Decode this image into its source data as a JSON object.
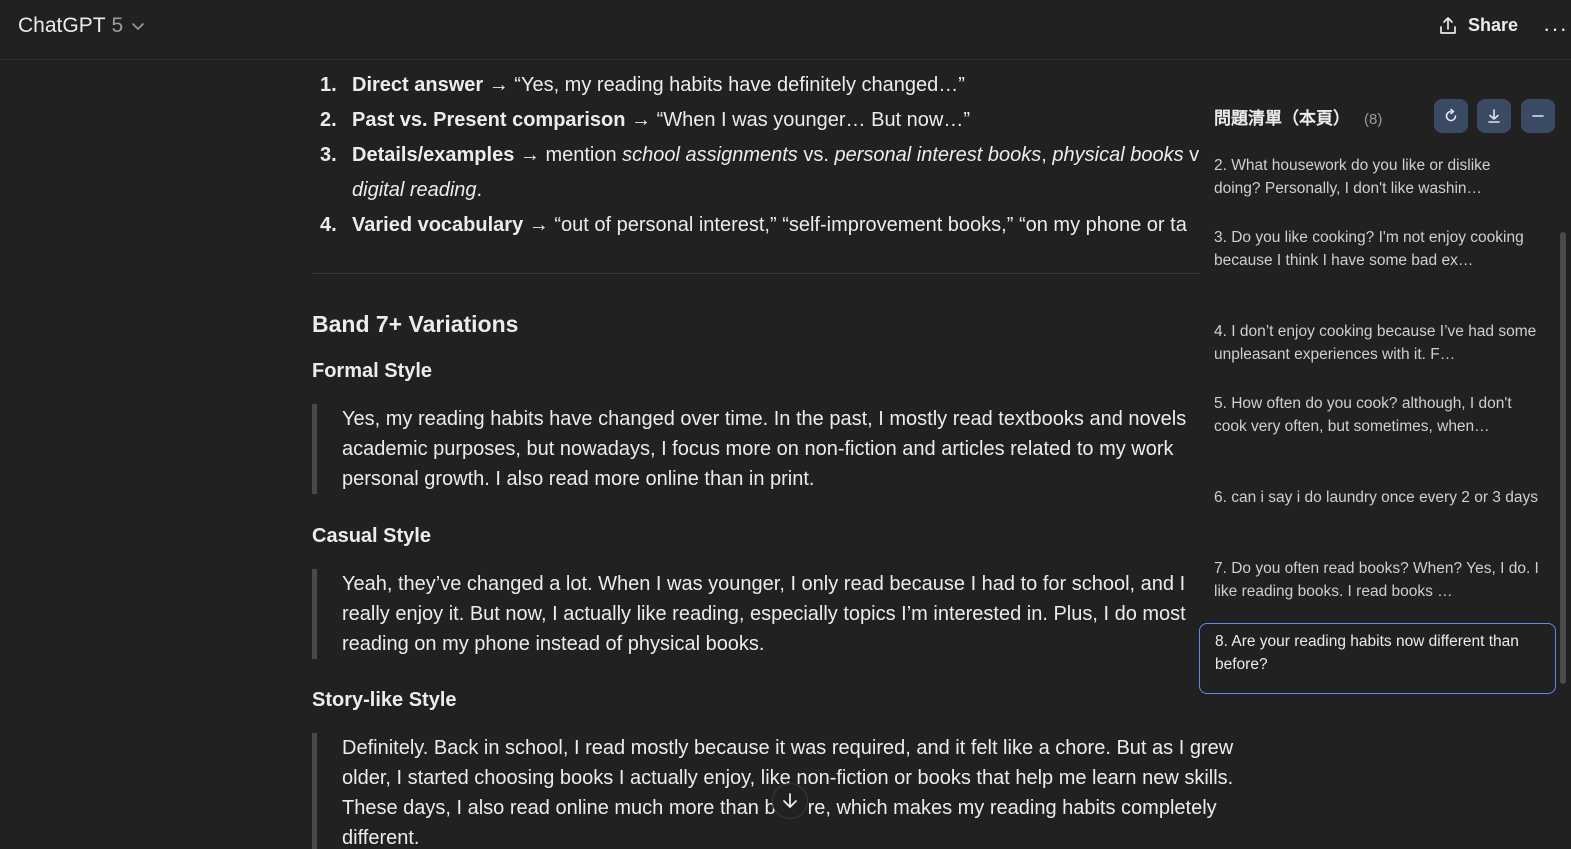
{
  "header": {
    "model_name": "ChatGPT",
    "model_version": "5",
    "share_label": "Share",
    "more_label": "···"
  },
  "answer": {
    "list": [
      {
        "num": "1.",
        "bold": "Direct answer",
        "rest": " → “Yes, my reading habits have definitely changed…”"
      },
      {
        "num": "2.",
        "bold": "Past vs. Present comparison",
        "rest": " → “When I was younger… But now…”"
      },
      {
        "num": "4.",
        "bold": "Varied vocabulary",
        "rest": " → “out of personal interest,” “self-improvement books,” “on my phone or ta"
      }
    ],
    "item3": {
      "num": "3.",
      "bold": "Details/examples",
      "pre": " → mention ",
      "i1": "school assignments",
      "mid1": " vs. ",
      "i2": "personal interest books",
      "mid2": ", ",
      "i3": "physical books",
      "tail": " v",
      "i4": "digital reading",
      "end": "."
    },
    "band_heading": "Band 7+ Variations",
    "styles": [
      {
        "heading": "Formal Style",
        "lines": [
          "Yes, my reading habits have changed over time. In the past, I mostly read textbooks and novels",
          "academic purposes, but nowadays, I focus more on non-fiction and articles related to my work",
          "personal growth. I also read more online than in print."
        ]
      },
      {
        "heading": "Casual Style",
        "lines": [
          "Yeah, they’ve changed a lot. When I was younger, I only read because I had to for school, and I",
          "really enjoy it. But now, I actually like reading, especially topics I’m interested in. Plus, I do most",
          "reading on my phone instead of physical books."
        ]
      },
      {
        "heading": "Story-like Style",
        "lines": [
          "Definitely. Back in school, I read mostly because it was required, and it felt like a chore. But as I grew",
          "older, I started choosing books I actually enjoy, like non-fiction or books that help me learn new skills.",
          "These days, I also read online much more than b",
          "different."
        ],
        "line3_tail": "re, which makes my reading habits completely"
      }
    ]
  },
  "question_panel": {
    "title": "問題清單（本頁）",
    "count": "(8)",
    "items": [
      {
        "text": "2. What housework do you like or dislike doing? Personally, I don't like washin…"
      },
      {
        "text": "3. Do you like cooking? I'm not enjoy cooking because I think I have some bad ex…"
      },
      {
        "text": "4. I don’t enjoy cooking because I’ve had some unpleasant experiences with it. F…"
      },
      {
        "text": "5. How often do you cook? although, I don't cook very often, but sometimes, when…"
      },
      {
        "text": "6. can i say i do laundry once every 2 or 3 days"
      },
      {
        "text": "7. Do you often read books? When? Yes, I do. I like reading books. I read books …"
      },
      {
        "text": "8. Are your reading habits now different than before?",
        "active": true
      }
    ]
  },
  "icons": [
    "chevron-down-icon",
    "share-icon",
    "more-icon",
    "refresh-icon",
    "download-icon",
    "minimize-icon",
    "arrow-down-icon"
  ],
  "colors": {
    "background": "#212121",
    "text": "#ececec",
    "panel_button": "#3b4a63",
    "active_border": "#5b8de8"
  }
}
